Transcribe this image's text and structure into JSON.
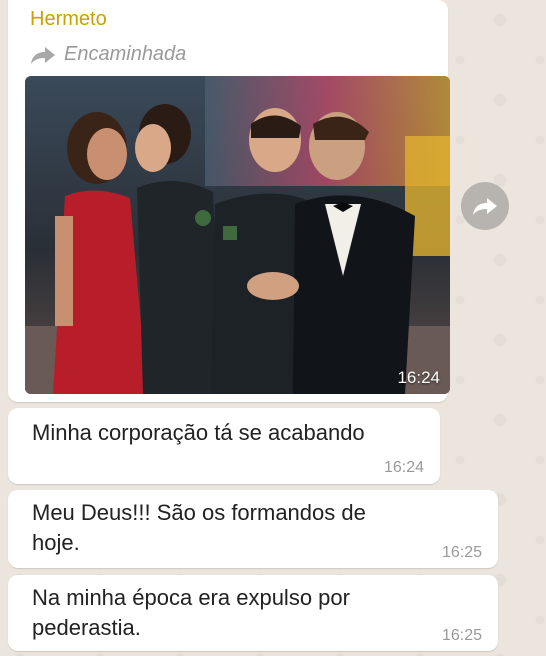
{
  "message_1": {
    "sender": "Hermeto",
    "forwarded_label": "Encaminhada",
    "photo_time": "16:24",
    "icon": "forward-arrow-icon"
  },
  "share_button": {
    "icon": "share-arrow-icon"
  },
  "message_2": {
    "text": "Minha corporação tá se acabando",
    "time": "16:24"
  },
  "message_3": {
    "line1": "Meu Deus!!! São os formandos de",
    "line2": "hoje.",
    "time": "16:25"
  },
  "message_4": {
    "line1": "Na minha época era expulso por",
    "line2": "pederastia.",
    "time": "16:25"
  },
  "colors": {
    "sender_name": "#c9a100",
    "chat_background": "#ece5dd",
    "bubble": "#ffffff"
  }
}
